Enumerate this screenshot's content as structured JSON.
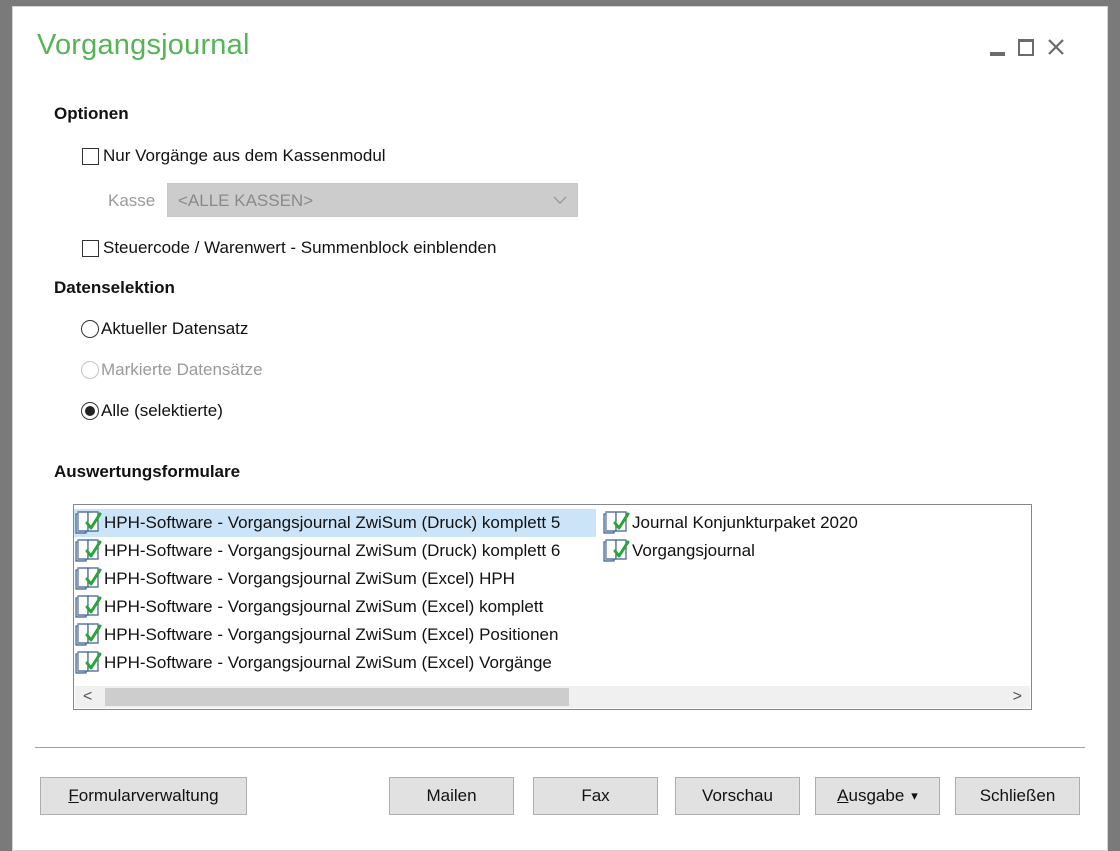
{
  "window": {
    "title": "Vorgangsjournal",
    "controls": [
      "minimize-icon",
      "maximize-icon",
      "close-icon"
    ]
  },
  "options": {
    "heading": "Optionen",
    "only_cash_module": {
      "label": "Nur Vorgänge aus dem Kassenmodul",
      "checked": false
    },
    "kasse": {
      "label": "Kasse",
      "value": "<ALLE KASSEN>",
      "enabled": false
    },
    "tax_summary_block": {
      "label": "Steuercode / Warenwert - Summenblock einblenden",
      "checked": false
    }
  },
  "data_selection": {
    "heading": "Datenselektion",
    "options": [
      {
        "label": "Aktueller Datensatz",
        "selected": false,
        "enabled": true
      },
      {
        "label": "Markierte Datensätze",
        "selected": false,
        "enabled": false
      },
      {
        "label": "Alle (selektierte)",
        "selected": true,
        "enabled": true
      }
    ]
  },
  "forms": {
    "heading": "Auswertungsformulare",
    "column1": [
      "HPH-Software - Vorgangsjournal ZwiSum (Druck) komplett 5",
      "HPH-Software - Vorgangsjournal ZwiSum (Druck) komplett 6",
      "HPH-Software - Vorgangsjournal ZwiSum (Excel) HPH",
      "HPH-Software - Vorgangsjournal ZwiSum (Excel) komplett",
      "HPH-Software - Vorgangsjournal ZwiSum (Excel) Positionen",
      "HPH-Software - Vorgangsjournal ZwiSum (Excel) Vorgänge"
    ],
    "column2": [
      "Journal Konjunkturpaket 2020",
      "Vorgangsjournal"
    ],
    "selected_item": "HPH-Software - Vorgangsjournal ZwiSum (Druck) komplett 5",
    "scroll_left": "<",
    "scroll_right": ">"
  },
  "buttons": {
    "formularverwaltung": {
      "first": "F",
      "rest": "ormularverwaltung"
    },
    "mailen": "Mailen",
    "fax": "Fax",
    "vorschau": "Vorschau",
    "ausgabe": {
      "first": "A",
      "rest": "usgabe",
      "arrow": "▾"
    },
    "schliessen": "Schließen"
  },
  "colors": {
    "title": "#55b554",
    "selection": "#cce4f7",
    "button_face": "#e1e1e1",
    "disabled_field": "#cccccc"
  }
}
